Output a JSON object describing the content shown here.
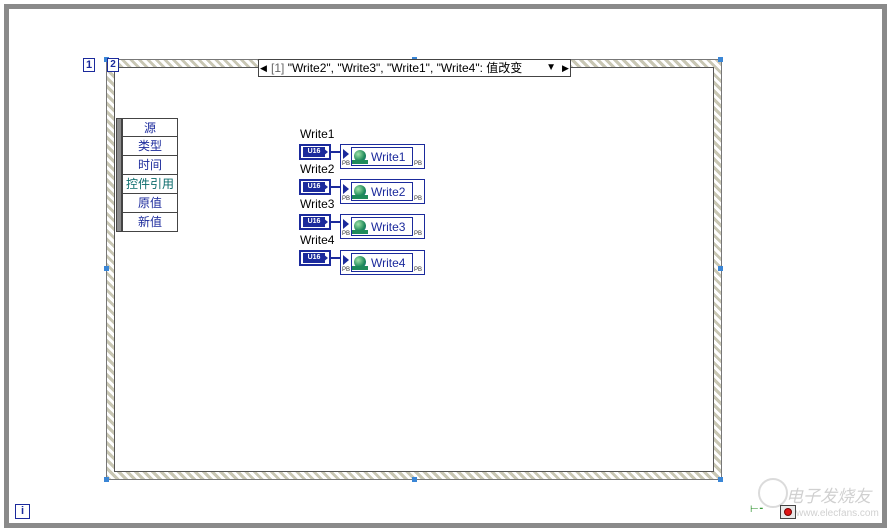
{
  "loop": {
    "iteration_label": "i",
    "stop_value": "1",
    "stop_glyph": "2"
  },
  "event_case": {
    "index": "[1]",
    "text": "\"Write2\", \"Write3\", \"Write1\", \"Write4\": 值改变"
  },
  "event_data_fields": [
    "源",
    "类型",
    "时间",
    "控件引用",
    "原值",
    "新值"
  ],
  "nodes": [
    {
      "label": "Write1",
      "type": "U16",
      "property_name": "Write1",
      "pb": "PB"
    },
    {
      "label": "Write2",
      "type": "U16",
      "property_name": "Write2",
      "pb": "PB"
    },
    {
      "label": "Write3",
      "type": "U16",
      "property_name": "Write3",
      "pb": "PB"
    },
    {
      "label": "Write4",
      "type": "U16",
      "property_name": "Write4",
      "pb": "PB"
    }
  ],
  "watermark": {
    "main": "电子发烧友",
    "sub": "www.elecfans.com"
  },
  "colors": {
    "wire_blue": "#1b2a9c",
    "stop_red": "#e01414",
    "frame_gray": "#8a8a8a",
    "handle_blue": "#3a86d6"
  }
}
